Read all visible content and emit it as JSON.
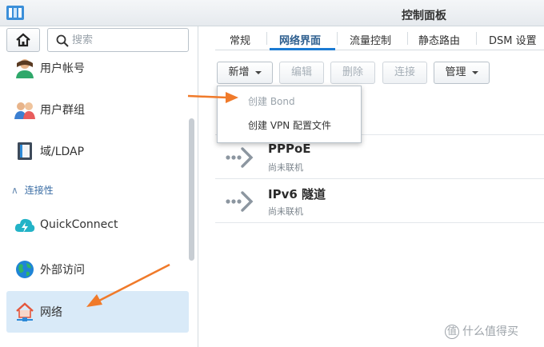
{
  "window": {
    "title": "控制面板"
  },
  "sidebar": {
    "search_placeholder": "搜索",
    "items": [
      {
        "label": "用户帐号",
        "icon": "user-icon"
      },
      {
        "label": "用户群组",
        "icon": "user-group-icon"
      },
      {
        "label": "域/LDAP",
        "icon": "domain-ldap-icon"
      },
      {
        "label": "QuickConnect",
        "icon": "quickconnect-icon"
      },
      {
        "label": "外部访问",
        "icon": "globe-icon"
      },
      {
        "label": "网络",
        "icon": "network-home-icon",
        "active": true
      }
    ],
    "section": "连接性"
  },
  "tabs": [
    {
      "label": "常规"
    },
    {
      "label": "网络界面",
      "active": true
    },
    {
      "label": "流量控制"
    },
    {
      "label": "静态路由"
    },
    {
      "label": "DSM 设置"
    }
  ],
  "toolbar": {
    "create": "新增",
    "edit": "编辑",
    "delete": "删除",
    "connect": "连接",
    "manage": "管理"
  },
  "dropdown": {
    "items": [
      {
        "label": "创建 Bond",
        "enabled": false
      },
      {
        "label": "创建 VPN 配置文件",
        "enabled": true
      }
    ]
  },
  "interfaces": [
    {
      "name": "PPPoE",
      "status": "尚未联机"
    },
    {
      "name": "IPv6 隧道",
      "status": "尚未联机"
    }
  ],
  "watermark": {
    "text": "什么值得买",
    "logo": "值"
  },
  "colors": {
    "accent": "#1b7bd3",
    "arrow": "#f07a2a",
    "active_bg": "#d9eaf8"
  }
}
